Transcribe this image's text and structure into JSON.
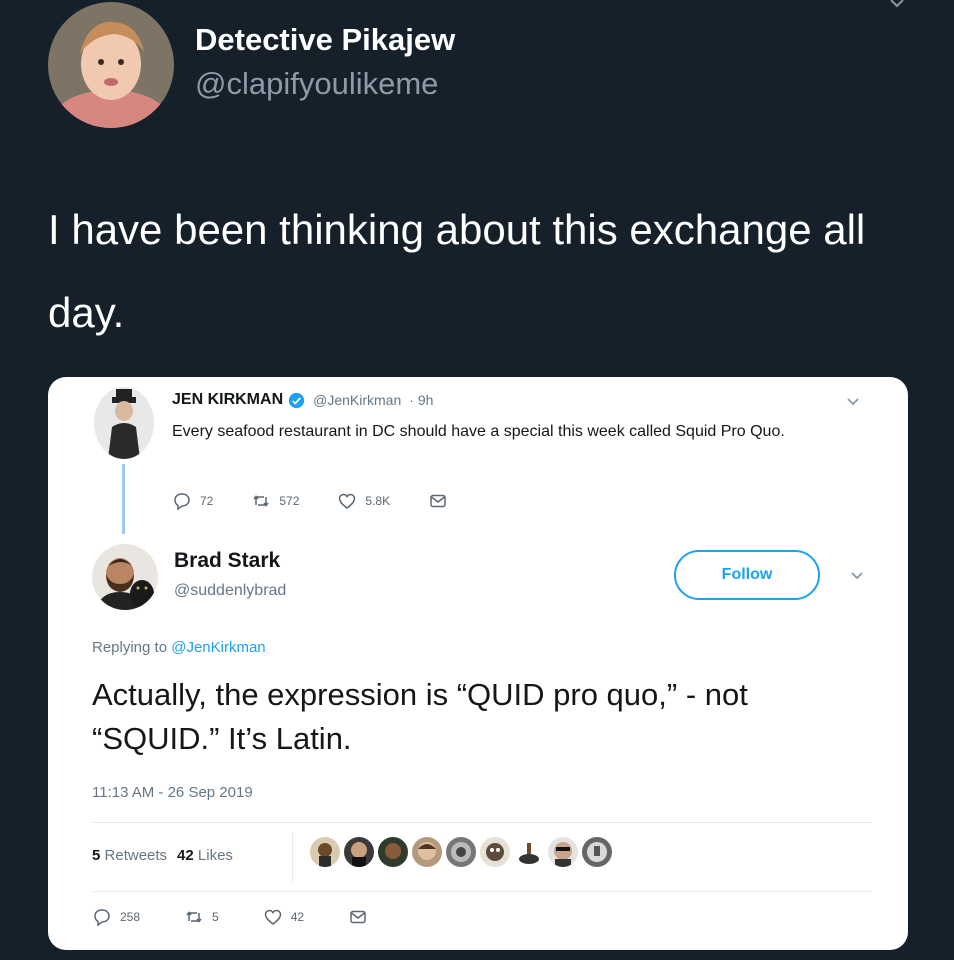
{
  "tweet": {
    "name": "Detective Pikajew",
    "handle": "@clapifyoulikeme",
    "text": "I have been thinking about this exchange all day."
  },
  "quoted": {
    "original": {
      "name": "JEN KIRKMAN",
      "handle": "@JenKirkman",
      "time": "· 9h",
      "text": "Every seafood restaurant in DC should have a special this week called Squid Pro Quo.",
      "replies": "72",
      "retweets": "572",
      "likes": "5.8K"
    },
    "reply": {
      "name": "Brad Stark",
      "handle": "@suddenlybrad",
      "follow_label": "Follow",
      "replying_prefix": "Replying to",
      "replying_to": "@JenKirkman",
      "text": "Actually, the expression is “QUID pro quo,” - not “SQUID.” It’s Latin.",
      "timestamp": "11:13 AM - 26 Sep 2019",
      "retweet_count": "5",
      "retweet_label": "Retweets",
      "like_count": "42",
      "like_label": "Likes",
      "replies": "258",
      "retweets": "5",
      "likes": "42"
    }
  },
  "colors": {
    "background": "#15202b",
    "accent": "#1da1f2",
    "secondary_text": "#657786"
  },
  "icons": [
    "reply-icon",
    "retweet-icon",
    "like-icon",
    "message-icon",
    "verified-icon",
    "chevron-down-icon"
  ]
}
